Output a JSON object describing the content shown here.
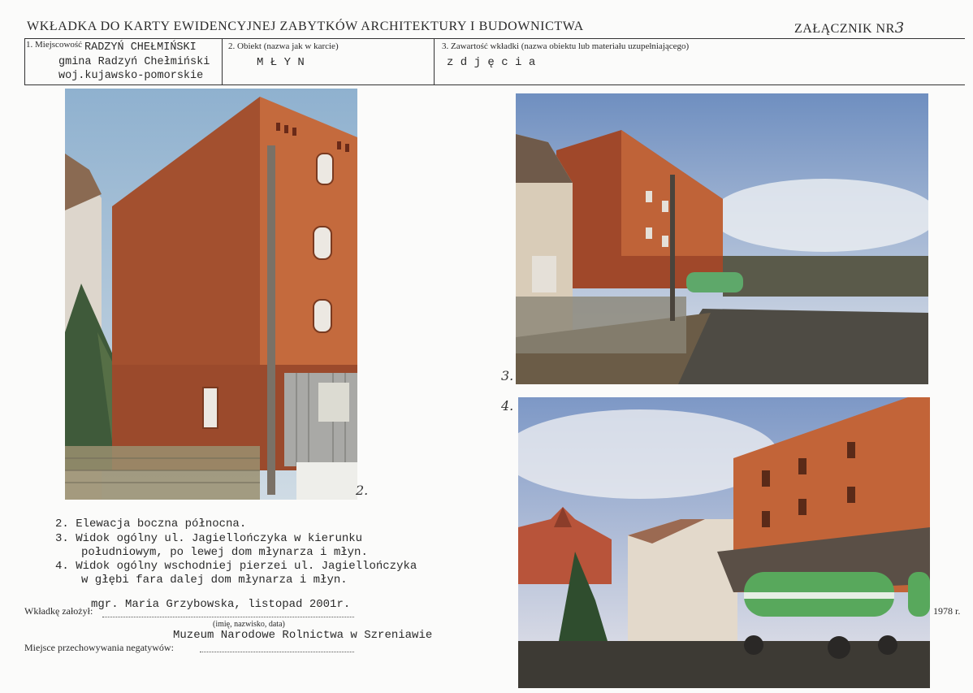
{
  "header": {
    "title": "WKŁADKA DO KARTY EWIDENCYJNEJ ZABYTKÓW ARCHITEKTURY I BUDOWNICTWA",
    "attachment_label": "ZAŁĄCZNIK NR",
    "attachment_number": "3"
  },
  "fields": {
    "locality_label": "1. Miejscowość",
    "locality_value": "RADZYŃ CHEŁMIŃSKI",
    "locality_line2": "gmina Radzyń Chełmiński",
    "locality_line3": "woj.kujawsko-pomorskie",
    "object_label": "2. Obiekt (nazwa jak w karcie)",
    "object_value": "M Ł Y N",
    "content_label": "3. Zawartość wkładki (nazwa obiektu lub materiału uzupełniającego)",
    "content_value": "z d j ę c i a"
  },
  "photos": {
    "p2_number": "2.",
    "p3_number": "3.",
    "p4_number": "4."
  },
  "captions": {
    "c2": "2. Elewacja boczna północna.",
    "c3a": "3. Widok ogólny ul. Jagiellończyka w kierunku",
    "c3b": "południowym, po lewej dom młynarza i młyn.",
    "c4a": "4. Widok ogólny wschodniej pierzei ul. Jagiellończyka",
    "c4b": "w głębi fara dalej dom młynarza i młyn."
  },
  "footer": {
    "author_value": "mgr. Maria Grzybowska, listopad 2001r.",
    "author_label": "Wkładkę założył:",
    "author_hint": "(imię, nazwisko, data)",
    "storage_value": "Muzeum Narodowe Rolnictwa w Szreniawie",
    "storage_label": "Miejsce przechowywania negatywów:",
    "year": "1978 r."
  }
}
